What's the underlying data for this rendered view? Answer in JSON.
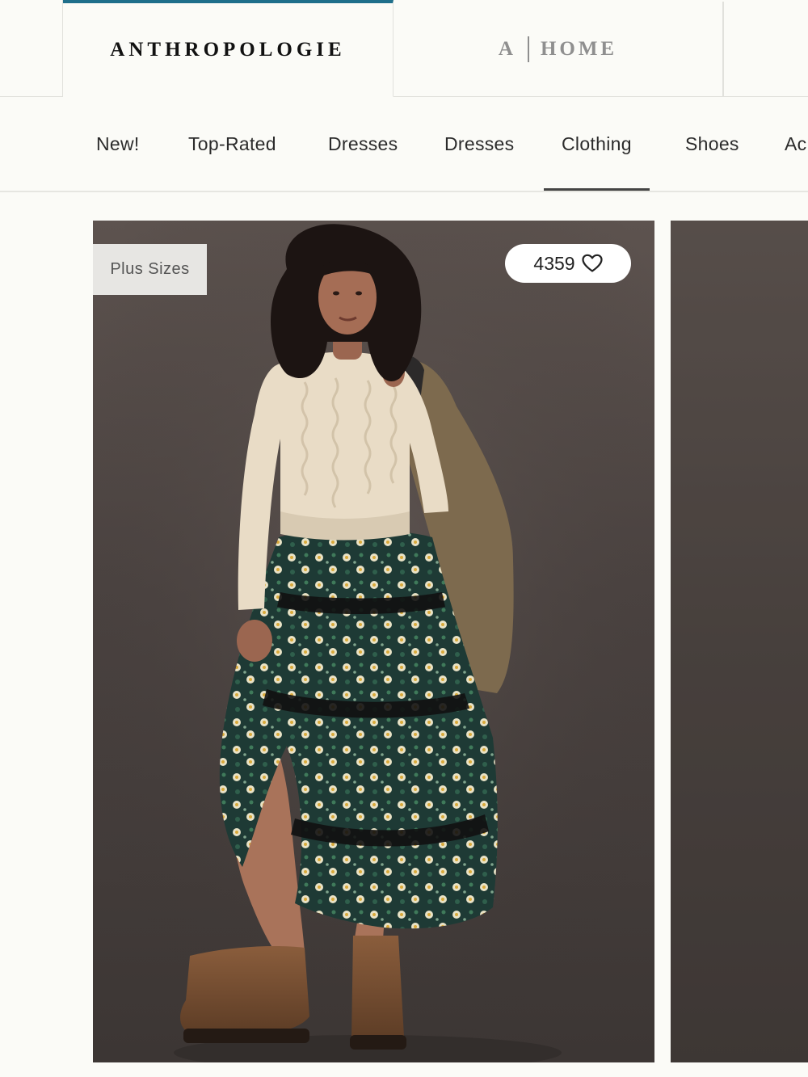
{
  "brands": {
    "primary": "ANTHROPOLOGIE",
    "home_mark": "A",
    "home_label": "HOME"
  },
  "categories": [
    {
      "label": "New!"
    },
    {
      "label": "Top-Rated"
    },
    {
      "label": "Dresses"
    },
    {
      "label": "Dresses"
    },
    {
      "label": "Clothing",
      "active": true
    },
    {
      "label": "Shoes"
    },
    {
      "label": "Ac"
    }
  ],
  "product": {
    "badge": "Plus Sizes",
    "likes": "4359",
    "like_icon": "heart-outline-icon"
  },
  "colors": {
    "accent": "#1f6f8b",
    "background": "#fbfbf7"
  }
}
